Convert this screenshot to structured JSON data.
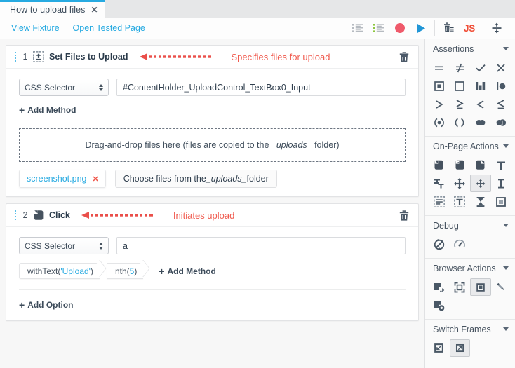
{
  "tab": {
    "label": "How to upload files",
    "close_icon": "close-icon"
  },
  "toolbar": {
    "links": [
      {
        "label": "View Fixture",
        "name": "view-fixture-link"
      },
      {
        "label": "Open Tested Page",
        "name": "open-tested-page-link"
      }
    ],
    "actions": [
      {
        "name": "list-unordered-icon",
        "kind": "list-gray"
      },
      {
        "name": "list-ordered-icon",
        "kind": "list-green"
      },
      {
        "name": "record-icon",
        "kind": "record"
      },
      {
        "name": "run-icon",
        "kind": "play"
      },
      {
        "name": "delete-test-icon",
        "kind": "trash-lines"
      },
      {
        "name": "js-code-icon",
        "kind": "js",
        "label": "JS"
      },
      {
        "name": "collapse-all-icon",
        "kind": "collapse"
      }
    ],
    "accent_blue": "#27aae1",
    "record_red": "#ef5a6b",
    "js_orange": "#f04e37"
  },
  "steps": [
    {
      "number": "1",
      "title": "Set Files to Upload",
      "icon": "upload-file-icon",
      "annotation": "Specifies files for upload",
      "delete_icon": "trash-icon",
      "selector_type": "CSS Selector",
      "selector_value": "#ContentHolder_UploadControl_TextBox0_Input",
      "add_method_label": "Add Method",
      "dropzone_text_pre": "Drag-and-drop files here (files are copied to the ",
      "dropzone_text_em": "_uploads_",
      "dropzone_text_post": " folder)",
      "file_chip": {
        "name": "screenshot.png",
        "remove_icon": "remove-file-icon"
      },
      "choose_pre": "Choose files from the ",
      "choose_em": "_uploads_",
      "choose_post": " folder"
    },
    {
      "number": "2",
      "title": "Click",
      "icon": "mouse-click-icon",
      "annotation": "Initiates upload",
      "delete_icon": "trash-icon",
      "selector_type": "CSS Selector",
      "selector_value": "a",
      "methods": [
        {
          "name": "withText",
          "pre": "withText(",
          "arg": "'Upload'",
          "post": ")"
        },
        {
          "name": "nth",
          "pre": "nth(",
          "arg": "5",
          "post": ")"
        }
      ],
      "add_method_label": "Add Method",
      "add_option_label": "Add Option"
    }
  ],
  "panel": {
    "groups": [
      {
        "title": "Assertions",
        "name": "group-assertions",
        "icons": [
          {
            "name": "eql-icon",
            "glyph": "="
          },
          {
            "name": "not-eql-icon",
            "glyph": "≠"
          },
          {
            "name": "ok-icon",
            "glyph": "✓"
          },
          {
            "name": "not-ok-icon",
            "glyph": "✕"
          },
          {
            "name": "contains-icon",
            "glyph": "▣"
          },
          {
            "name": "not-contains-icon",
            "glyph": "□"
          },
          {
            "name": "type-of-icon",
            "glyph": "◧"
          },
          {
            "name": "not-type-of-icon",
            "glyph": "◔"
          },
          {
            "name": "gt-icon",
            "glyph": ">"
          },
          {
            "name": "gte-icon",
            "glyph": "≥"
          },
          {
            "name": "lt-icon",
            "glyph": "<"
          },
          {
            "name": "lte-icon",
            "glyph": "≤"
          },
          {
            "name": "within-icon",
            "glyph": "◉"
          },
          {
            "name": "not-within-icon",
            "glyph": "()"
          },
          {
            "name": "match-icon",
            "glyph": "●●"
          },
          {
            "name": "not-match-icon",
            "glyph": "●◖"
          }
        ]
      },
      {
        "title": "On-Page Actions",
        "name": "group-onpage-actions",
        "icons": [
          {
            "name": "click-icon",
            "glyph": "click"
          },
          {
            "name": "double-click-icon",
            "glyph": "dblclick"
          },
          {
            "name": "right-click-icon",
            "glyph": "rclick"
          },
          {
            "name": "type-text-icon",
            "glyph": "T"
          },
          {
            "name": "drag-icon",
            "glyph": "drag"
          },
          {
            "name": "drag-to-element-icon",
            "glyph": "move"
          },
          {
            "name": "hover-icon",
            "glyph": "hover",
            "selected": true
          },
          {
            "name": "select-text-icon",
            "glyph": "I"
          },
          {
            "name": "select-editable-content-icon",
            "glyph": "seltext"
          },
          {
            "name": "select-text-area-content-icon",
            "glyph": "selarea"
          },
          {
            "name": "wait-icon",
            "glyph": "⌛"
          },
          {
            "name": "press-key-icon",
            "glyph": "■"
          }
        ]
      },
      {
        "title": "Debug",
        "name": "group-debug",
        "icons": [
          {
            "name": "debug-icon",
            "glyph": "debug"
          },
          {
            "name": "set-speed-icon",
            "glyph": "speed"
          }
        ]
      },
      {
        "title": "Browser Actions",
        "name": "group-browser-actions",
        "icons": [
          {
            "name": "resize-window-icon",
            "glyph": "resize"
          },
          {
            "name": "maximize-window-icon",
            "glyph": "maximize"
          },
          {
            "name": "resize-to-fit-device-icon",
            "glyph": "fitdevice",
            "selected": true
          },
          {
            "name": "set-test-speed-icon",
            "glyph": "pencil"
          },
          {
            "name": "take-screenshot-icon",
            "glyph": "screenshot"
          }
        ]
      },
      {
        "title": "Switch Frames",
        "name": "group-switch-frames",
        "icons": [
          {
            "name": "switch-to-iframe-icon",
            "glyph": "toframe"
          },
          {
            "name": "switch-to-main-window-icon",
            "glyph": "tomain",
            "selected": true
          }
        ]
      }
    ]
  }
}
